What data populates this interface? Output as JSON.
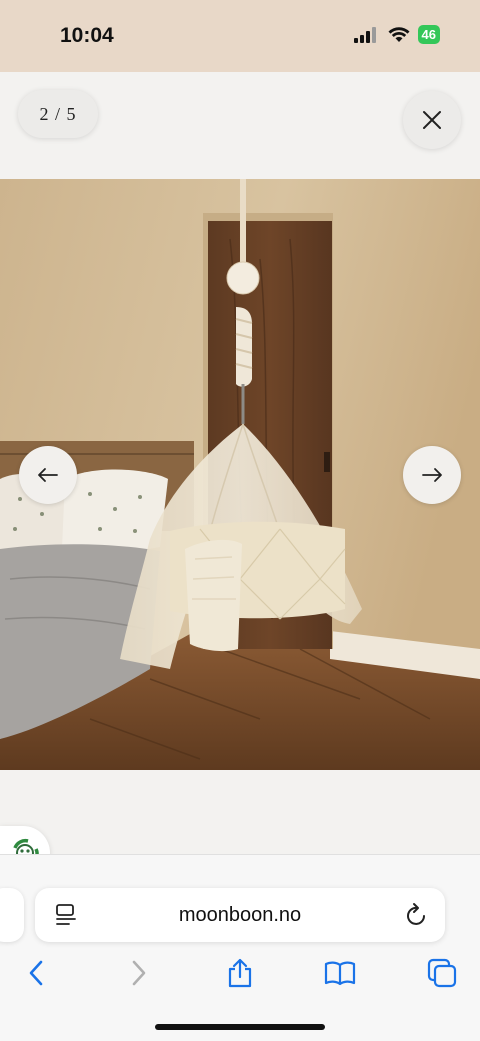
{
  "status_bar": {
    "time": "10:04",
    "battery": "46",
    "icons": [
      "cellular-signal-icon",
      "wifi-icon",
      "battery-icon"
    ]
  },
  "gallery": {
    "counter": "2 / 5",
    "close_icon": "close-icon",
    "prev_icon": "arrow-left-icon",
    "next_icon": "arrow-right-icon",
    "image_subject": "hanging cradle with canopy in bedroom"
  },
  "eco_badge": {
    "icon": "recycle-icon"
  },
  "browser": {
    "url": "moonboon.no",
    "page_menu_icon": "page-menu-icon",
    "reload_icon": "reload-icon",
    "toolbar": [
      "back-icon",
      "forward-icon",
      "share-icon",
      "bookmarks-icon",
      "tabs-icon"
    ],
    "accent_color": "#1a73e8",
    "disabled_color": "#b0b0b0"
  }
}
